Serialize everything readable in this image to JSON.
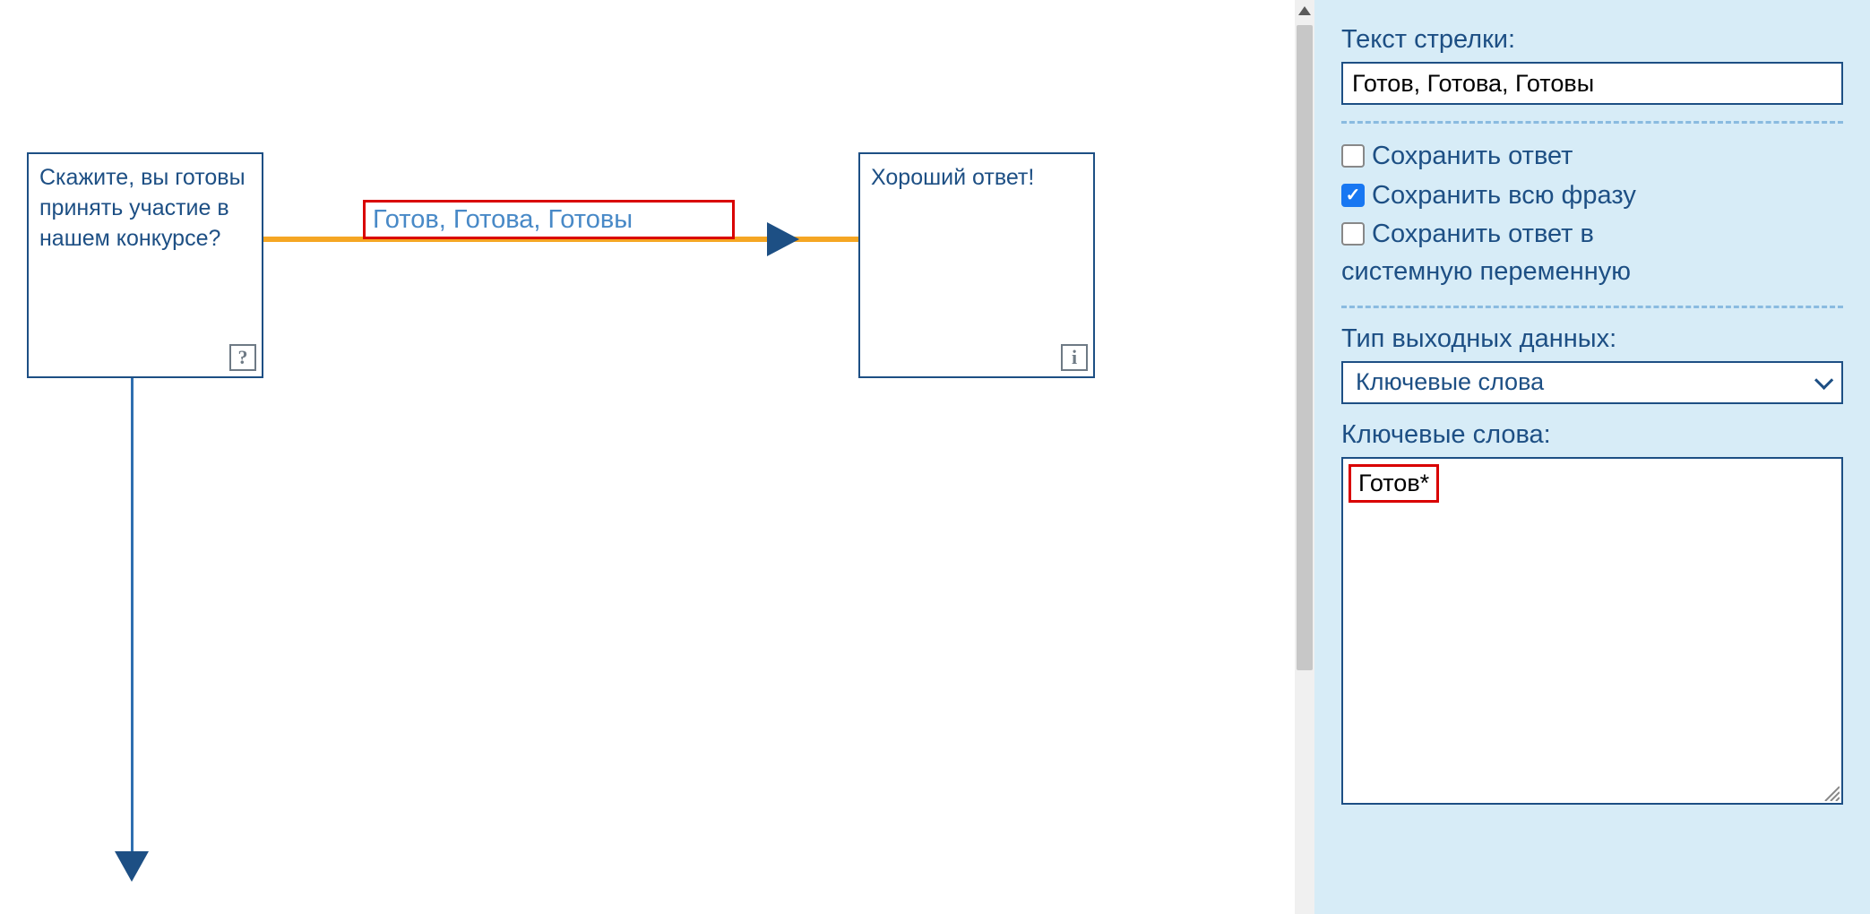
{
  "canvas": {
    "node1_text": "Скажите, вы готовы принять участие в нашем конкурсе?",
    "node1_footer_icon": "?",
    "node2_text": "Хороший ответ!",
    "node2_footer_icon": "i",
    "arrow_label": "Готов, Готова, Готовы"
  },
  "sidebar": {
    "arrow_text_label": "Текст стрелки:",
    "arrow_text_value": "Готов, Готова, Готовы",
    "save_answer_label": "Сохранить ответ",
    "save_answer_checked": false,
    "save_phrase_label": "Сохранить всю фразу",
    "save_phrase_checked": true,
    "save_sysvar_label_line1": "Сохранить ответ в",
    "save_sysvar_label_line2": "системную переменную",
    "save_sysvar_checked": false,
    "output_type_label": "Тип выходных данных:",
    "output_type_value": "Ключевые слова",
    "keywords_label": "Ключевые слова:",
    "keyword_value": "Готов*"
  }
}
